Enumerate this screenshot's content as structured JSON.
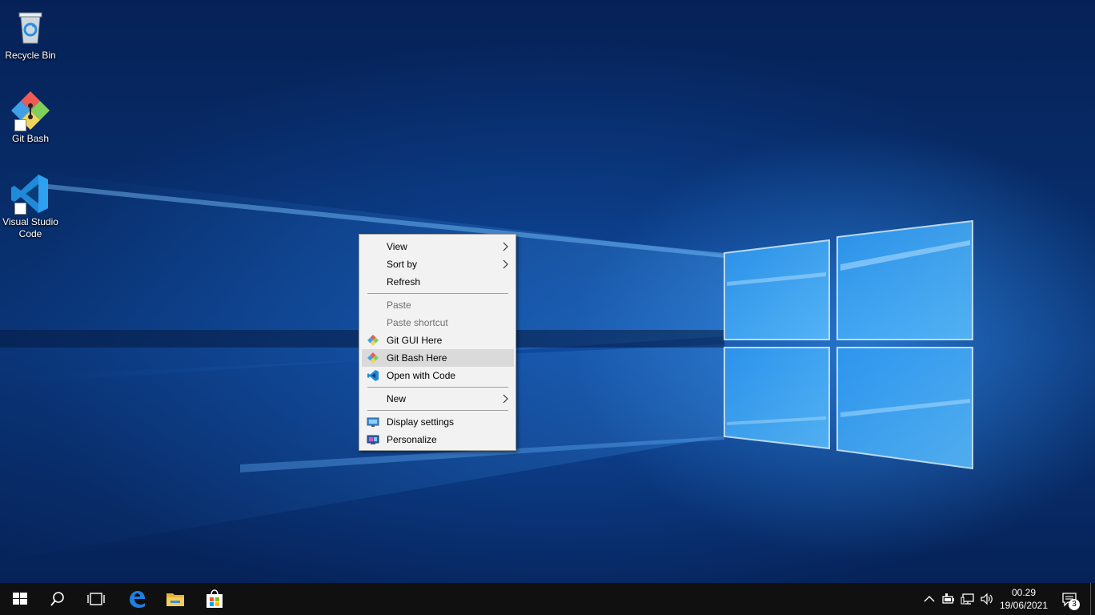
{
  "desktop": {
    "icons": [
      {
        "label": "Recycle Bin"
      },
      {
        "label": "Git Bash"
      },
      {
        "label": "Visual Studio Code"
      }
    ]
  },
  "context_menu": {
    "items": {
      "view": {
        "label": "View",
        "has_submenu": true
      },
      "sort_by": {
        "label": "Sort by",
        "has_submenu": true
      },
      "refresh": {
        "label": "Refresh"
      },
      "paste": {
        "label": "Paste",
        "disabled": true
      },
      "paste_shortcut": {
        "label": "Paste shortcut",
        "disabled": true
      },
      "git_gui": {
        "label": "Git GUI Here",
        "icon": "git-icon"
      },
      "git_bash": {
        "label": "Git Bash Here",
        "icon": "git-icon",
        "highlighted": true
      },
      "open_code": {
        "label": "Open with Code",
        "icon": "vscode-icon"
      },
      "new": {
        "label": "New",
        "has_submenu": true
      },
      "display_settings": {
        "label": "Display settings",
        "icon": "display-icon"
      },
      "personalize": {
        "label": "Personalize",
        "icon": "personalize-icon"
      }
    }
  },
  "taskbar": {
    "clock": {
      "time": "00.29",
      "date": "19/06/2021"
    },
    "notifications_count": "3"
  },
  "colors": {
    "taskbar": "#101010",
    "menu_background": "#f2f2f2",
    "menu_highlight": "#dadada",
    "accent": "#0078d7"
  }
}
